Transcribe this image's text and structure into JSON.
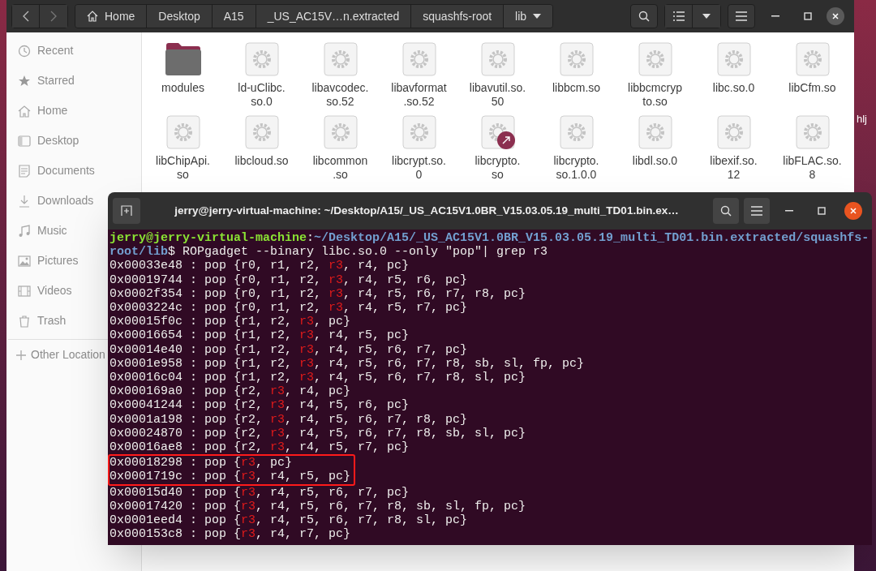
{
  "files_window": {
    "breadcrumbs": [
      {
        "label": "Home",
        "selected": false
      },
      {
        "label": "Desktop",
        "selected": false
      },
      {
        "label": "A15",
        "selected": false
      },
      {
        "label": "_US_AC15V…n.extracted",
        "selected": false
      },
      {
        "label": "squashfs-root",
        "selected": false
      },
      {
        "label": "lib",
        "selected": true
      }
    ],
    "sidebar": {
      "items": [
        {
          "label": "Recent"
        },
        {
          "label": "Starred"
        },
        {
          "label": "Home"
        },
        {
          "label": "Desktop"
        },
        {
          "label": "Documents"
        },
        {
          "label": "Downloads"
        },
        {
          "label": "Music"
        },
        {
          "label": "Pictures"
        },
        {
          "label": "Videos"
        },
        {
          "label": "Trash"
        }
      ],
      "other": "Other Location"
    },
    "files": [
      {
        "name": "modules",
        "kind": "folder",
        "link": false
      },
      {
        "name": "ld-uClibc.\nso.0",
        "kind": "file",
        "link": false
      },
      {
        "name": "libavcodec.\nso.52",
        "kind": "file",
        "link": false
      },
      {
        "name": "libavformat\n.so.52",
        "kind": "file",
        "link": false
      },
      {
        "name": "libavutil.so.\n50",
        "kind": "file",
        "link": false
      },
      {
        "name": "libbcm.so",
        "kind": "file",
        "link": false
      },
      {
        "name": "libbcmcryp\nto.so",
        "kind": "file",
        "link": false
      },
      {
        "name": "libc.so.0",
        "kind": "file",
        "link": false
      },
      {
        "name": "libCfm.so",
        "kind": "file",
        "link": false
      },
      {
        "name": "libChipApi.\nso",
        "kind": "file",
        "link": false
      },
      {
        "name": "libcloud.so",
        "kind": "file",
        "link": false
      },
      {
        "name": "libcommon\n.so",
        "kind": "file",
        "link": false
      },
      {
        "name": "libcrypt.so.\n0",
        "kind": "file",
        "link": false
      },
      {
        "name": "libcrypto.\nso",
        "kind": "file",
        "link": true
      },
      {
        "name": "libcrypto.\nso.1.0.0",
        "kind": "file",
        "link": false
      },
      {
        "name": "libdl.so.0",
        "kind": "file",
        "link": false
      },
      {
        "name": "libexif.so.\n12",
        "kind": "file",
        "link": false
      },
      {
        "name": "libFLAC.so.\n8",
        "kind": "file",
        "link": false
      }
    ]
  },
  "desktop_label": "hlj",
  "terminal": {
    "title": "jerry@jerry-virtual-machine: ~/Desktop/A15/_US_AC15V1.0BR_V15.03.05.19_multi_TD01.bin.ex…",
    "prompt": {
      "user": "jerry@jerry-virtual-machine",
      "separator": ":",
      "path": "~/Desktop/A15/_US_AC15V1.0BR_V15.03.05.19_multi_TD01.bin.extracted/squashfs-root/lib",
      "command": "$ ROPgadget --binary libc.so.0 --only \"pop\"| grep r3"
    },
    "lines": [
      {
        "before": "0x00033e48 : pop {r0, r1, r2, ",
        "match": "r3",
        "after": ", r4, pc}",
        "highlighted": false
      },
      {
        "before": "0x00019744 : pop {r0, r1, r2, ",
        "match": "r3",
        "after": ", r4, r5, r6, pc}",
        "highlighted": false
      },
      {
        "before": "0x0002f354 : pop {r0, r1, r2, ",
        "match": "r3",
        "after": ", r4, r5, r6, r7, r8, pc}",
        "highlighted": false
      },
      {
        "before": "0x0003224c : pop {r0, r1, r2, ",
        "match": "r3",
        "after": ", r4, r5, r7, pc}",
        "highlighted": false
      },
      {
        "before": "0x00015f0c : pop {r1, r2, ",
        "match": "r3",
        "after": ", pc}",
        "highlighted": false
      },
      {
        "before": "0x00016654 : pop {r1, r2, ",
        "match": "r3",
        "after": ", r4, r5, pc}",
        "highlighted": false
      },
      {
        "before": "0x00014e40 : pop {r1, r2, ",
        "match": "r3",
        "after": ", r4, r5, r6, r7, pc}",
        "highlighted": false
      },
      {
        "before": "0x0001e958 : pop {r1, r2, ",
        "match": "r3",
        "after": ", r4, r5, r6, r7, r8, sb, sl, fp, pc}",
        "highlighted": false
      },
      {
        "before": "0x00016c04 : pop {r1, r2, ",
        "match": "r3",
        "after": ", r4, r5, r6, r7, r8, sl, pc}",
        "highlighted": false
      },
      {
        "before": "0x000169a0 : pop {r2, ",
        "match": "r3",
        "after": ", r4, pc}",
        "highlighted": false
      },
      {
        "before": "0x00041244 : pop {r2, ",
        "match": "r3",
        "after": ", r4, r5, r6, pc}",
        "highlighted": false
      },
      {
        "before": "0x0001a198 : pop {r2, ",
        "match": "r3",
        "after": ", r4, r5, r6, r7, r8, pc}",
        "highlighted": false
      },
      {
        "before": "0x00024870 : pop {r2, ",
        "match": "r3",
        "after": ", r4, r5, r6, r7, r8, sb, sl, pc}",
        "highlighted": false
      },
      {
        "before": "0x00016ae8 : pop {r2, ",
        "match": "r3",
        "after": ", r4, r5, r7, pc}",
        "highlighted": false
      },
      {
        "before": "0x00018298 : pop {",
        "match": "r3",
        "after": ", pc}",
        "highlighted": true
      },
      {
        "before": "0x0001719c : pop {",
        "match": "r3",
        "after": ", r4, r5, pc}",
        "highlighted": true
      },
      {
        "before": "0x00015d40 : pop {",
        "match": "r3",
        "after": ", r4, r5, r6, r7, pc}",
        "highlighted": false
      },
      {
        "before": "0x00017420 : pop {",
        "match": "r3",
        "after": ", r4, r5, r6, r7, r8, sb, sl, fp, pc}",
        "highlighted": false
      },
      {
        "before": "0x0001eed4 : pop {",
        "match": "r3",
        "after": ", r4, r5, r6, r7, r8, sl, pc}",
        "highlighted": false
      },
      {
        "before": "0x000153c8 : pop {",
        "match": "r3",
        "after": ", r4, r7, pc}",
        "highlighted": false
      }
    ]
  }
}
